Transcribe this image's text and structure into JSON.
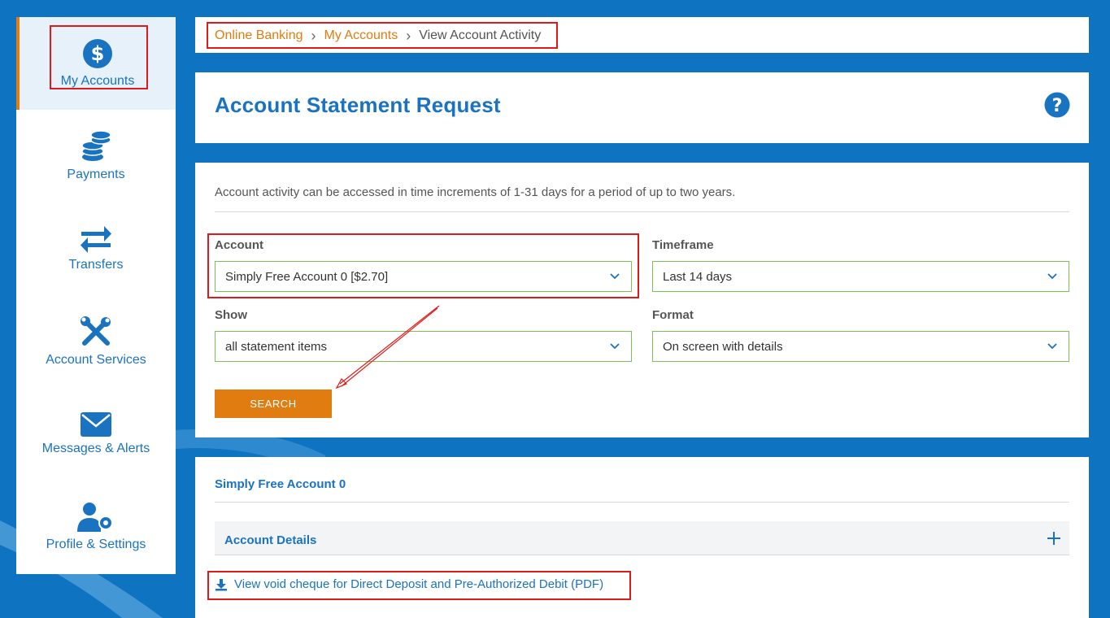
{
  "sidebar": {
    "items": [
      {
        "label": "My Accounts",
        "icon": "dollar-circle-icon"
      },
      {
        "label": "Payments",
        "icon": "coins-icon"
      },
      {
        "label": "Transfers",
        "icon": "transfer-arrows-icon"
      },
      {
        "label": "Account Services",
        "icon": "tools-icon"
      },
      {
        "label": "Messages & Alerts",
        "icon": "envelope-icon"
      },
      {
        "label": "Profile & Settings",
        "icon": "user-gear-icon"
      }
    ]
  },
  "breadcrumb": {
    "items": [
      "Online Banking",
      "My Accounts",
      "View Account Activity"
    ]
  },
  "header": {
    "title": "Account Statement Request",
    "help_icon": "question-circle-icon"
  },
  "form": {
    "intro": "Account activity can be accessed in time increments of 1-31 days for a period of up to two years.",
    "account": {
      "label": "Account",
      "value": "Simply Free Account 0 [$2.70]"
    },
    "timeframe": {
      "label": "Timeframe",
      "value": "Last 14 days"
    },
    "show": {
      "label": "Show",
      "value": "all statement items"
    },
    "format": {
      "label": "Format",
      "value": "On screen with details"
    },
    "search_label": "SEARCH"
  },
  "results": {
    "account_name": "Simply Free Account 0",
    "details_label": "Account Details",
    "void_cheque_link": "View void cheque for Direct Deposit and Pre-Authorized Debit (PDF)"
  },
  "colors": {
    "background": "#0e74c2",
    "accent": "#e07c10",
    "link": "#1a73c0",
    "highlight": "#e01a1a",
    "field_border": "#7dc05a"
  }
}
